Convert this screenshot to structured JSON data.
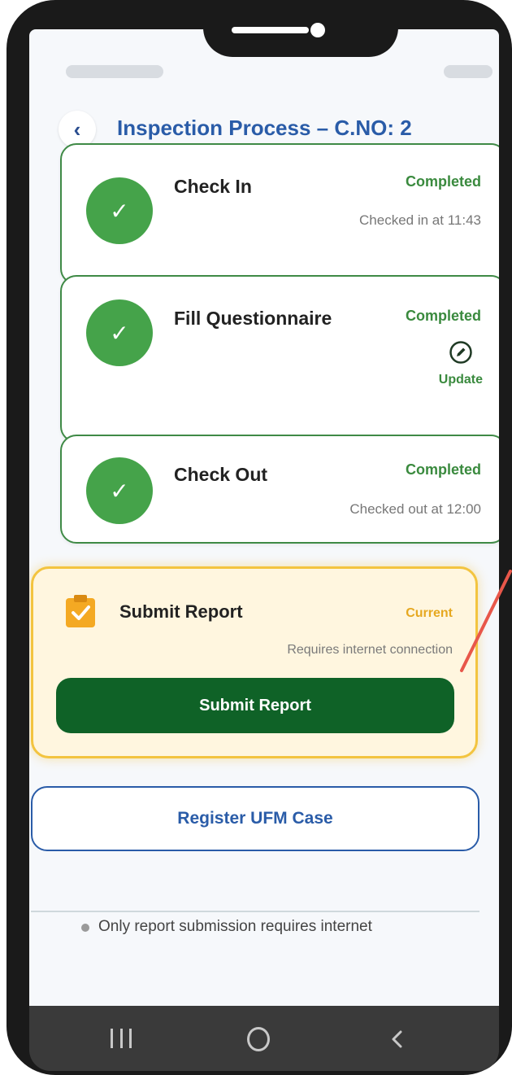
{
  "header": {
    "title": "Inspection Process – C.NO: 2",
    "back_icon": "chevron-left-icon"
  },
  "steps": [
    {
      "title": "Check In",
      "status": "Completed",
      "detail": "Checked in at 11:43",
      "icon": "check-circle-icon"
    },
    {
      "title": "Fill Questionnaire",
      "status": "Completed",
      "action_label": "Update",
      "action_icon": "edit-icon",
      "icon": "check-circle-icon"
    },
    {
      "title": "Check Out",
      "status": "Completed",
      "detail": "Checked out at 12:00",
      "icon": "check-circle-icon"
    }
  ],
  "current_step": {
    "title": "Submit Report",
    "status": "Current",
    "detail": "Requires internet connection",
    "button_label": "Submit Report",
    "icon": "clipboard-check-icon"
  },
  "ufm_button_label": "Register UFM Case",
  "footer_note": "Only report submission requires internet",
  "nav": {
    "recent_icon": "recent-apps-icon",
    "home_icon": "home-icon",
    "back_icon": "back-icon"
  },
  "colors": {
    "primary_blue": "#2a5ca8",
    "completed_green": "#45a34a",
    "submit_green": "#0f6227",
    "current_amber": "#f3c440"
  }
}
